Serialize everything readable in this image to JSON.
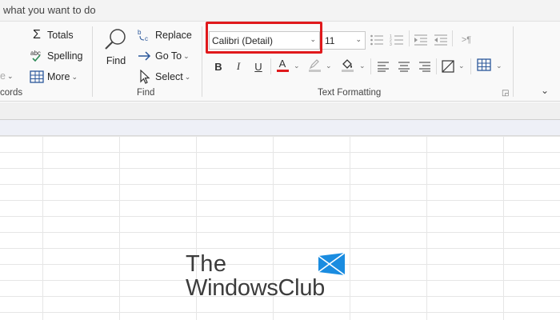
{
  "tell_me": {
    "text": "what you want to do"
  },
  "ribbon": {
    "records_group": {
      "label": "cords",
      "more": "More",
      "partial_glyph": "e"
    },
    "editing": {
      "totals": "Totals",
      "spelling": "Spelling"
    },
    "find_group": {
      "label": "Find",
      "find": "Find",
      "replace": "Replace",
      "goto": "Go To",
      "select": "Select"
    },
    "text_formatting": {
      "label": "Text Formatting",
      "font_name": "Calibri (Detail)",
      "font_size": "11",
      "bold": "B",
      "italic": "I",
      "underline": "U",
      "font_color_letter": "A",
      "font_color": "#e0191c",
      "highlight_color": "#c8c8c8",
      "fill_color": "#c8c8c8",
      "rtl_glyph": ">¶"
    }
  },
  "watermark": {
    "line1": "The",
    "line2": "WindowsClub"
  }
}
